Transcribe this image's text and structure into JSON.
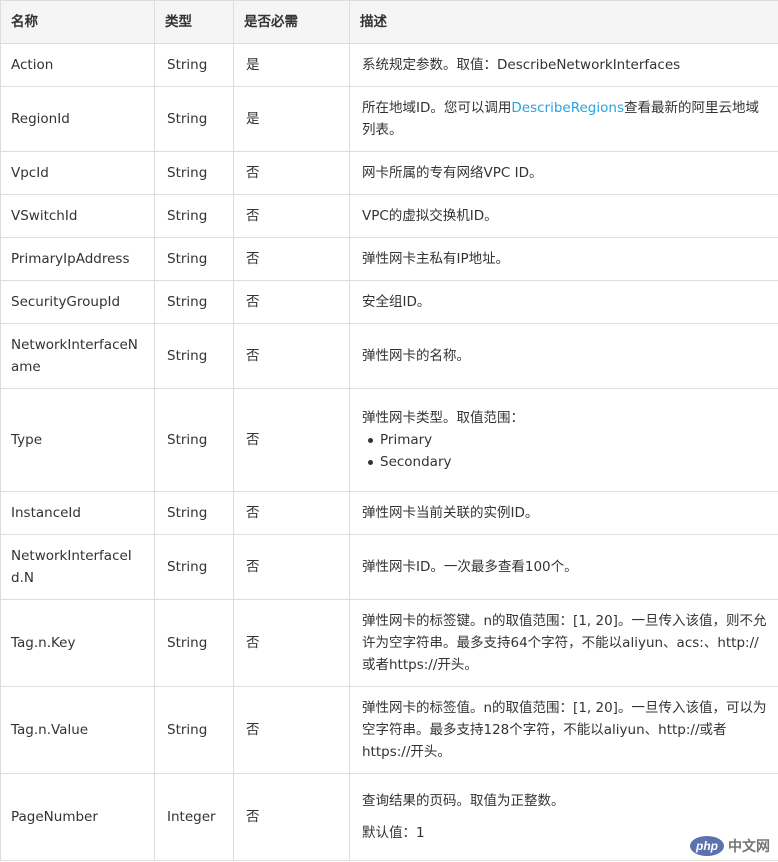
{
  "header": {
    "name": "名称",
    "type": "类型",
    "required": "是否必需",
    "desc": "描述"
  },
  "rows": [
    {
      "name": "Action",
      "type": "String",
      "required": "是",
      "desc": "系统规定参数。取值：DescribeNetworkInterfaces"
    },
    {
      "name": "RegionId",
      "type": "String",
      "required": "是",
      "desc_pre": "所在地域ID。您可以调用",
      "desc_link": "DescribeRegions",
      "desc_post": "查看最新的阿里云地域列表。"
    },
    {
      "name": "VpcId",
      "type": "String",
      "required": "否",
      "desc": "网卡所属的专有网络VPC ID。"
    },
    {
      "name": "VSwitchId",
      "type": "String",
      "required": "否",
      "desc": "VPC的虚拟交换机ID。"
    },
    {
      "name": "PrimaryIpAddress",
      "type": "String",
      "required": "否",
      "desc": "弹性网卡主私有IP地址。"
    },
    {
      "name": "SecurityGroupId",
      "type": "String",
      "required": "否",
      "desc": "安全组ID。"
    },
    {
      "name": "NetworkInterfaceName",
      "type": "String",
      "required": "否",
      "desc": "弹性网卡的名称。"
    },
    {
      "name": "Type",
      "type": "String",
      "required": "否",
      "desc": "弹性网卡类型。取值范围：",
      "options": [
        "Primary",
        "Secondary"
      ]
    },
    {
      "name": "InstanceId",
      "type": "String",
      "required": "否",
      "desc": "弹性网卡当前关联的实例ID。"
    },
    {
      "name": "NetworkInterfaceId.N",
      "type": "String",
      "required": "否",
      "desc": "弹性网卡ID。一次最多查看100个。"
    },
    {
      "name": "Tag.n.Key",
      "type": "String",
      "required": "否",
      "desc": "弹性网卡的标签键。n的取值范围：[1, 20]。一旦传入该值，则不允许为空字符串。最多支持64个字符，不能以aliyun、acs:、http://或者https://开头。"
    },
    {
      "name": "Tag.n.Value",
      "type": "String",
      "required": "否",
      "desc": "弹性网卡的标签值。n的取值范围：[1, 20]。一旦传入该值，可以为空字符串。最多支持128个字符，不能以aliyun、http://或者https://开头。"
    },
    {
      "name": "PageNumber",
      "type": "Integer",
      "required": "否",
      "desc": "查询结果的页码。取值为正整数。",
      "desc2": "默认值：1"
    }
  ],
  "watermark": {
    "logo": "php",
    "text": "中文网"
  }
}
